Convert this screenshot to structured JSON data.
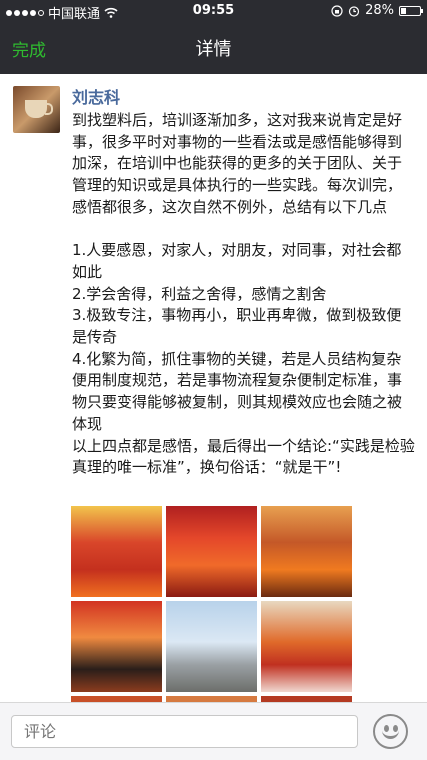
{
  "status_bar": {
    "carrier": "中国联通",
    "time": "09:55",
    "battery": "28%",
    "battery_level": 0.28
  },
  "nav": {
    "done_label": "完成",
    "title": "详情"
  },
  "post": {
    "author": "刘志科",
    "text": "到找塑料后，培训逐渐加多，这对我来说肯定是好事，很多平时对事物的一些看法或是感悟能够得到加深，在培训中也能获得的更多的关于团队、关于管理的知识或是具体执行的一些实践。每次训完，感悟都很多，这次自然不例外，总结有以下几点\n\n1.人要感恩，对家人，对朋友，对同事，对社会都如此\n2.学会舍得，利益之舍得，感情之割舍\n3.极致专注，事物再小，职业再卑微，做到极致便是传奇\n4.化繁为简，抓住事物的关键，若是人员结构复杂便用制度规范，若是事物流程复杂便制定标准，事物只要变得能够被复制，则其规模效应也会随之被体现\n以上四点都是感悟，最后得出一个结论:“实践是检验真理的唯一标准”，换句俗话：“就是干”!"
  },
  "comment_bar": {
    "placeholder": "评论"
  }
}
